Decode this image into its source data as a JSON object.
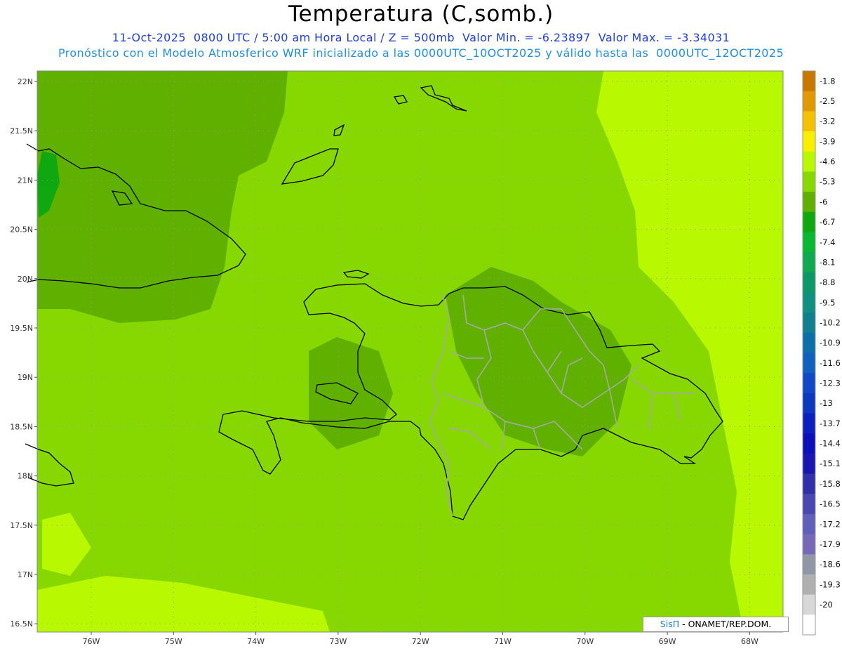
{
  "title": "Temperatura (C,somb.)",
  "subtitle_1": "11-Oct-2025  0800 UTC / 5:00 am Hora Local / Z = 500mb  Valor Min. = -6.23897  Valor Max. = -3.34031",
  "subtitle_2": "Pronóstico con el Modelo Atmosferico WRF inicializado a las 0000UTC_10OCT2025 y válido hasta las  0000UTC_12OCT2025",
  "lat_labels": [
    "22N",
    "21.5N",
    "21N",
    "20.5N",
    "20N",
    "19.5N",
    "19N",
    "18.5N",
    "18N",
    "17.5N",
    "17N",
    "16.5N"
  ],
  "lon_labels": [
    "76W",
    "75W",
    "74W",
    "73W",
    "72W",
    "71W",
    "70W",
    "69W",
    "68W"
  ],
  "colorbar": {
    "labels": [
      "-1.8",
      "-2.5",
      "-3.2",
      "-3.9",
      "-4.6",
      "-5.3",
      "-6",
      "-6.7",
      "-7.4",
      "-8.1",
      "-8.8",
      "-9.5",
      "-10.2",
      "-10.9",
      "-11.6",
      "-12.3",
      "-13",
      "-13.7",
      "-14.4",
      "-15.1",
      "-15.8",
      "-16.5",
      "-17.2",
      "-17.9",
      "-18.6",
      "-19.3",
      "-20"
    ],
    "colors": [
      "#c87800",
      "#e09a00",
      "#f4c000",
      "#f8f000",
      "#b8f800",
      "#86d800",
      "#60b000",
      "#10a810",
      "#08b830",
      "#10a850",
      "#0c9868",
      "#109080",
      "#108090",
      "#0c70a8",
      "#1060c0",
      "#1048c8",
      "#0c38c0",
      "#0c20c0",
      "#0c10b8",
      "#1818b0",
      "#3030a8",
      "#4848b0",
      "#6060b8",
      "#7868b8",
      "#9098a8",
      "#b0b0b0",
      "#d8d8d8",
      "#ffffff"
    ]
  },
  "credit": {
    "brand": "SisΠ",
    "text": "- ONAMET/REP.DOM."
  },
  "colors": {
    "field_base": "#86d800",
    "field_cool": "#60b000",
    "field_warm": "#b8f800",
    "coast": "#000000",
    "provinces": "#a8a8a8"
  }
}
